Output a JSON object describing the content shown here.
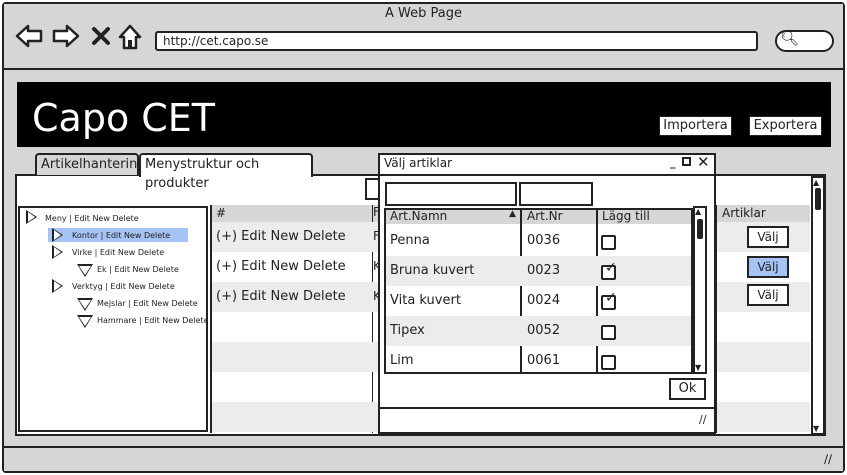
{
  "window": {
    "title": "A Web Page"
  },
  "nav": {
    "back_icon": "back-arrow-icon",
    "forward_icon": "forward-arrow-icon",
    "close_icon": "close-icon",
    "home_icon": "home-icon"
  },
  "address": {
    "url": "http://cet.capo.se"
  },
  "app": {
    "brand": "Capo CET",
    "import_label": "Importera",
    "export_label": "Exportera"
  },
  "tabs": [
    {
      "label": "Artikelhantering"
    },
    {
      "label": "Menystruktur och produkter"
    }
  ],
  "tree": [
    {
      "label": "Meny | Edit New Delete"
    },
    {
      "label": "Kontor | Edit New Delete"
    },
    {
      "label": "Virke | Edit New Delete"
    },
    {
      "label": "Ek | Edit New Delete"
    },
    {
      "label": "Verktyg | Edit New Delete"
    },
    {
      "label": "Mejslar | Edit New Delete"
    },
    {
      "label": "Hammare | Edit New Delete"
    }
  ],
  "grid": {
    "col_hash": "#",
    "col2_peek": "F",
    "rows": [
      {
        "label": "(+) Edit New Delete",
        "peek": "F"
      },
      {
        "label": "(+) Edit New Delete",
        "peek": "K"
      },
      {
        "label": "(+) Edit New Delete",
        "peek": "K"
      }
    ],
    "articles_header": "Artiklar",
    "select_buttons": [
      {
        "label": "Välj",
        "selected": false
      },
      {
        "label": "Välj",
        "selected": true
      },
      {
        "label": "Välj",
        "selected": false
      }
    ]
  },
  "dialog": {
    "title": "Välj artiklar",
    "columns": {
      "name": "Art.Namn",
      "number": "Art.Nr",
      "add": "Lägg till"
    },
    "items": [
      {
        "name": "Penna",
        "number": "0036",
        "checked": false
      },
      {
        "name": "Bruna kuvert",
        "number": "0023",
        "checked": true
      },
      {
        "name": "Vita kuvert",
        "number": "0024",
        "checked": true
      },
      {
        "name": "Tipex",
        "number": "0052",
        "checked": false
      },
      {
        "name": "Lim",
        "number": "0061",
        "checked": false
      }
    ],
    "ok_label": "Ok"
  },
  "colors": {
    "selected": "#a5c3f5",
    "header_bg": "#000000",
    "chrome": "#d6d6d6"
  }
}
